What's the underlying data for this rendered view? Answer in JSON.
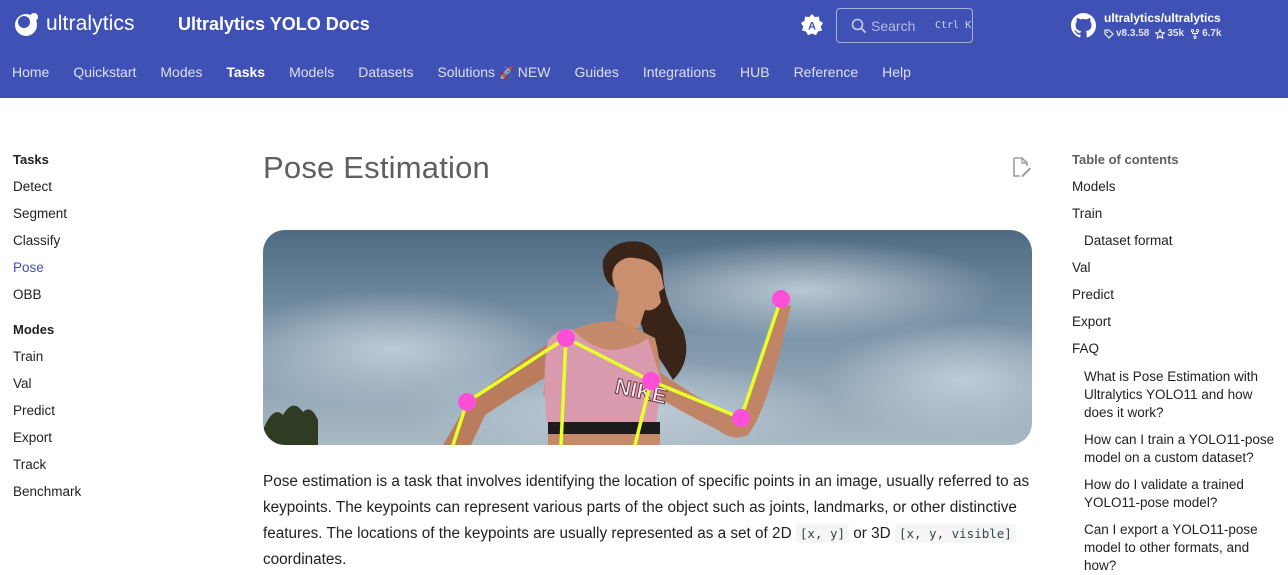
{
  "header": {
    "logo_text": "ultralytics",
    "site_title": "Ultralytics YOLO Docs",
    "search": {
      "placeholder": "Search",
      "shortcut": "Ctrl K"
    },
    "repo": {
      "name": "ultralytics/ultralytics",
      "version": "v8.3.58",
      "stars": "35k",
      "forks": "6.7k"
    }
  },
  "tabs": [
    {
      "label": "Home"
    },
    {
      "label": "Quickstart"
    },
    {
      "label": "Modes"
    },
    {
      "label": "Tasks"
    },
    {
      "label": "Models"
    },
    {
      "label": "Datasets"
    },
    {
      "label": "Solutions",
      "badge": "NEW"
    },
    {
      "label": "Guides"
    },
    {
      "label": "Integrations"
    },
    {
      "label": "HUB"
    },
    {
      "label": "Reference"
    },
    {
      "label": "Help"
    }
  ],
  "active_tab": "Tasks",
  "sidebar": {
    "tasks_heading": "Tasks",
    "tasks": [
      "Detect",
      "Segment",
      "Classify",
      "Pose",
      "OBB"
    ],
    "active_item": "Pose",
    "modes_heading": "Modes",
    "modes": [
      "Train",
      "Val",
      "Predict",
      "Export",
      "Track",
      "Benchmark"
    ]
  },
  "main": {
    "title": "Pose Estimation",
    "hero_brand_text": "NIKE",
    "paragraph": {
      "part1": "Pose estimation is a task that involves identifying the location of specific points in an image, usually referred to as keypoints. The keypoints can represent various parts of the object such as joints, landmarks, or other distinctive features. The locations of the keypoints are usually represented as a set of 2D ",
      "code1": "[x, y]",
      "part2": " or 3D ",
      "code2": "[x, y, visible]",
      "part3": " coordinates."
    }
  },
  "toc": {
    "title": "Table of contents",
    "items": [
      {
        "label": "Models",
        "level": 1
      },
      {
        "label": "Train",
        "level": 1
      },
      {
        "label": "Dataset format",
        "level": 2
      },
      {
        "label": "Val",
        "level": 1
      },
      {
        "label": "Predict",
        "level": 1
      },
      {
        "label": "Export",
        "level": 1
      },
      {
        "label": "FAQ",
        "level": 1
      },
      {
        "label": "What is Pose Estimation with Ultralytics YOLO11 and how does it work?",
        "level": 2
      },
      {
        "label": "How can I train a YOLO11-pose model on a custom dataset?",
        "level": 2
      },
      {
        "label": "How do I validate a trained YOLO11-pose model?",
        "level": 2
      },
      {
        "label": "Can I export a YOLO11-pose model to other formats, and how?",
        "level": 2
      }
    ]
  },
  "colors": {
    "primary": "#3f51b5",
    "keypoint": "#ff4fd8",
    "skeleton": "#e8ff2a"
  }
}
